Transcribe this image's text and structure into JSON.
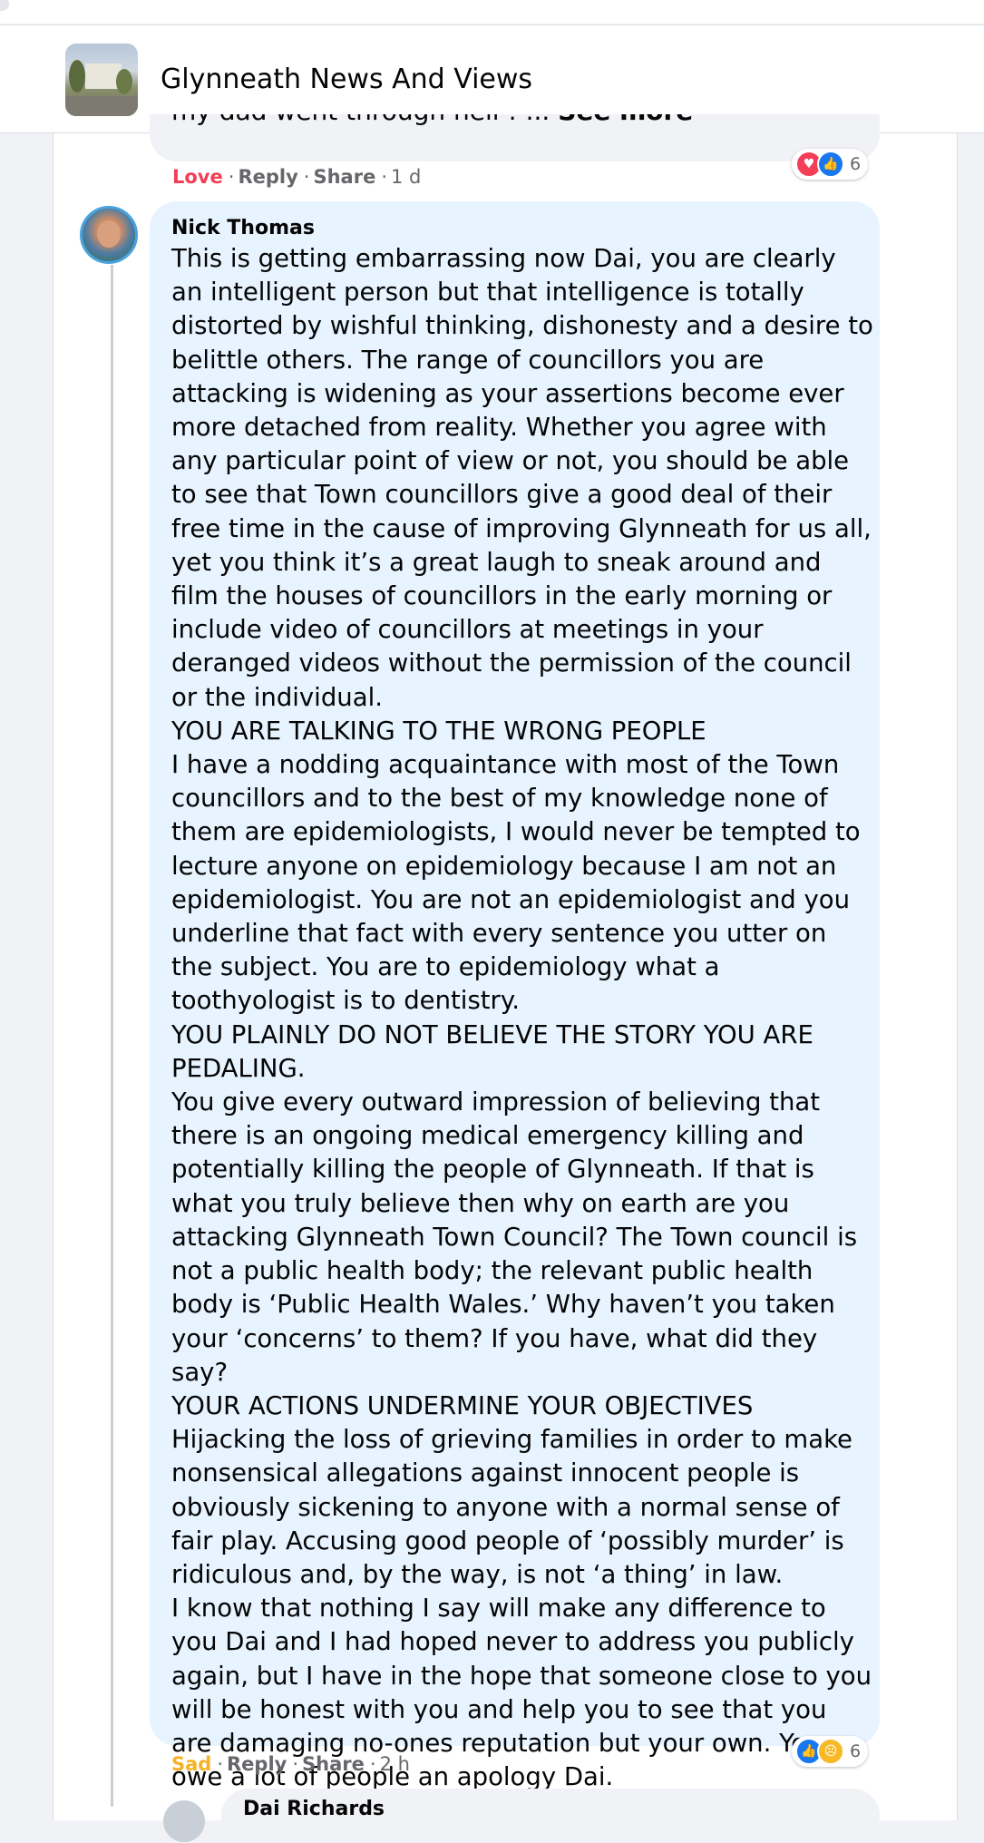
{
  "group": {
    "name": "Glynneath News And Views"
  },
  "previous_comment": {
    "text_fragment": "my dad went through hell ! ...",
    "see_more": "See more",
    "actions": {
      "reaction": "Love",
      "reply": "Reply",
      "share": "Share",
      "time": "1 d"
    },
    "reactions": {
      "icons": [
        "love-icon",
        "like-icon"
      ],
      "count": "6"
    }
  },
  "comment": {
    "author": "Nick Thomas",
    "body": [
      "This is getting embarrassing now Dai, you are clearly an intelligent person but that intelligence is totally distorted by wishful thinking, dishonesty and a desire to belittle others. The range of councillors you are attacking is widening as your assertions become ever more detached from reality. Whether you agree with any particular point of view or not, you should be able to see that Town councillors give a good deal of their free time in the cause of improving Glynneath for us all, yet you think it’s a great laugh to sneak around and film the houses of councillors in the early morning or include video of councillors at meetings in your deranged videos without the permission of the council or the individual.",
      "YOU ARE TALKING TO THE WRONG PEOPLE",
      "I have a nodding acquaintance with most of the Town councillors and to the best of my knowledge none of them are epidemiologists, I would never be tempted to lecture anyone on epidemiology because I am not an epidemiologist. You are not an epidemiologist and you underline that fact with every sentence you utter on the subject. You are to epidemiology what a toothyologist is to dentistry.",
      "YOU PLAINLY DO NOT BELIEVE THE STORY YOU ARE PEDALING.",
      "You give every outward impression of believing that there is an ongoing medical emergency killing and potentially killing the people of Glynneath. If that is what you truly believe then why on earth are you attacking Glynneath Town Council? The Town council is not a public health body; the relevant public health body is ‘Public Health Wales.’ Why haven’t you taken your ‘concerns’ to them? If you have, what did they say?",
      "YOUR ACTIONS UNDERMINE YOUR OBJECTIVES",
      "Hijacking the loss of grieving families in order to make nonsensical allegations against innocent people is obviously sickening to anyone with a normal sense of fair play. Accusing good people of ‘possibly murder’ is ridiculous and, by the way, is not ‘a thing’ in law.",
      "I know that nothing I say will make any difference to you Dai and I had hoped never to address you publicly again, but I have in the hope that someone close to you will be honest with you and help you to see that you are damaging no-ones reputation but your own. You owe a lot of people an apology Dai."
    ],
    "actions": {
      "reaction": "Sad",
      "reply": "Reply",
      "share": "Share",
      "time": "2 h"
    },
    "reactions": {
      "icons": [
        "like-icon",
        "sad-icon"
      ],
      "count": "6"
    }
  },
  "next_comment": {
    "author_partial": "Dai Richards"
  },
  "colors": {
    "love": "#f33e58",
    "sad": "#f7b125",
    "like": "#1877f2",
    "bubble": "#e7f3ff",
    "meta": "#65676b"
  }
}
